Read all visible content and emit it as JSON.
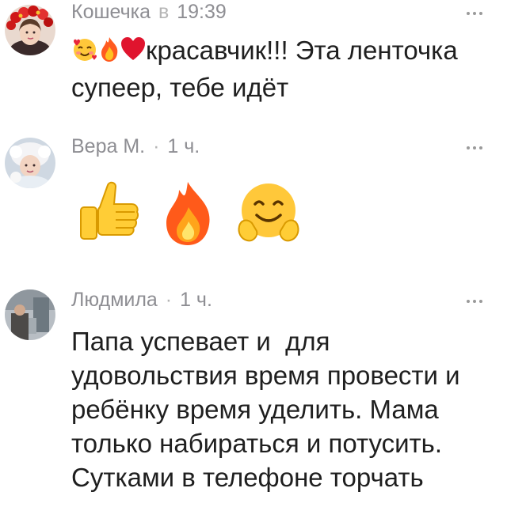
{
  "comments": [
    {
      "author": "Кошечка",
      "separator": "в",
      "time": "19:39",
      "text": "красавчик!!! Эта ленточка супеер, тебе идёт",
      "emoji_prefix": [
        "smiling-face-with-hearts-icon",
        "fire-icon",
        "red-heart-icon"
      ]
    },
    {
      "author": "Вера М.",
      "separator": "·",
      "time": "1 ч.",
      "emojis": [
        "thumbs-up-icon",
        "fire-icon",
        "hugging-face-icon"
      ]
    },
    {
      "author": "Людмила",
      "separator": "·",
      "time": "1 ч.",
      "text": "Папа успевает и  для удовольствия время провести и ребёнку время уделить. Мама только набираться и потусить. Сутками в телефоне торчать"
    }
  ],
  "colors": {
    "meta": "#8e8e93",
    "text": "#1f1f1f",
    "more_dots": "#9a9a9a"
  }
}
